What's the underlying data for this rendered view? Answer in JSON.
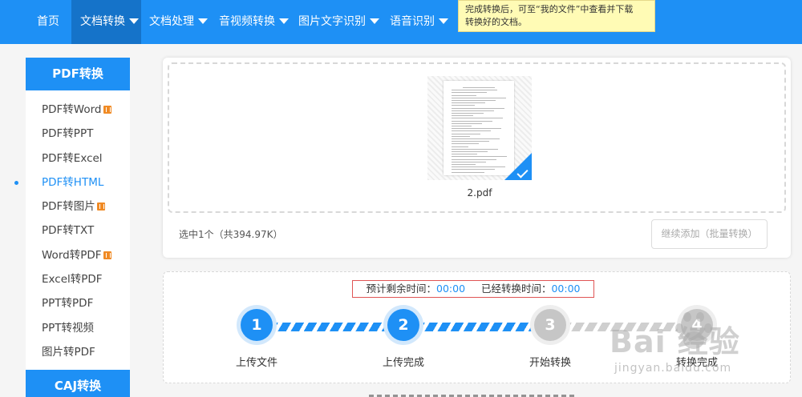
{
  "nav": {
    "items": [
      {
        "label": "首页",
        "has_caret": false,
        "active": false
      },
      {
        "label": "文档转换",
        "has_caret": true,
        "active": true
      },
      {
        "label": "文档处理",
        "has_caret": true,
        "active": false
      },
      {
        "label": "音视频转换",
        "has_caret": true,
        "active": false
      },
      {
        "label": "图片文字识别",
        "has_caret": true,
        "active": false
      },
      {
        "label": "语音识别",
        "has_caret": true,
        "active": false
      }
    ]
  },
  "tooltip": {
    "line1": "完成转换后，可至“我的文件”中查看并下载",
    "line2": "转换好的文档。"
  },
  "sidebar": {
    "section1_title": "PDF转换",
    "items": [
      {
        "label": "PDF转Word",
        "badge": true,
        "active": false
      },
      {
        "label": "PDF转PPT",
        "badge": false,
        "active": false
      },
      {
        "label": "PDF转Excel",
        "badge": false,
        "active": false
      },
      {
        "label": "PDF转HTML",
        "badge": false,
        "active": true
      },
      {
        "label": "PDF转图片",
        "badge": true,
        "active": false
      },
      {
        "label": "PDF转TXT",
        "badge": false,
        "active": false
      },
      {
        "label": "Word转PDF",
        "badge": true,
        "active": false
      },
      {
        "label": "Excel转PDF",
        "badge": false,
        "active": false
      },
      {
        "label": "PPT转PDF",
        "badge": false,
        "active": false
      },
      {
        "label": "PPT转视频",
        "badge": false,
        "active": false
      },
      {
        "label": "图片转PDF",
        "badge": false,
        "active": false
      }
    ],
    "section2_title": "CAJ转换"
  },
  "upload": {
    "file_name": "2.pdf",
    "selection_info": "选中1个（共394.97K）",
    "add_button_label": "继续添加（批量转换）"
  },
  "progress": {
    "remaining_label": "预计剩余时间：",
    "remaining_value": "00:00",
    "elapsed_label": "已经转换时间：",
    "elapsed_value": "00:00",
    "steps": [
      {
        "number": "1",
        "label": "上传文件",
        "done": true
      },
      {
        "number": "2",
        "label": "上传完成",
        "done": true
      },
      {
        "number": "3",
        "label": "开始转换",
        "done": false
      },
      {
        "number": "4",
        "label": "转换完成",
        "done": false
      }
    ]
  },
  "watermark": {
    "logo_text": "Bai 经验",
    "url_text": "jingyan.baidu.com"
  },
  "colors": {
    "primary": "#1e90f5",
    "nav_active": "#1573c9",
    "tooltip_bg": "#fffbb5",
    "badge": "#f08a24",
    "step_todo": "#c6c6c6",
    "time_box_border": "#e05555"
  }
}
